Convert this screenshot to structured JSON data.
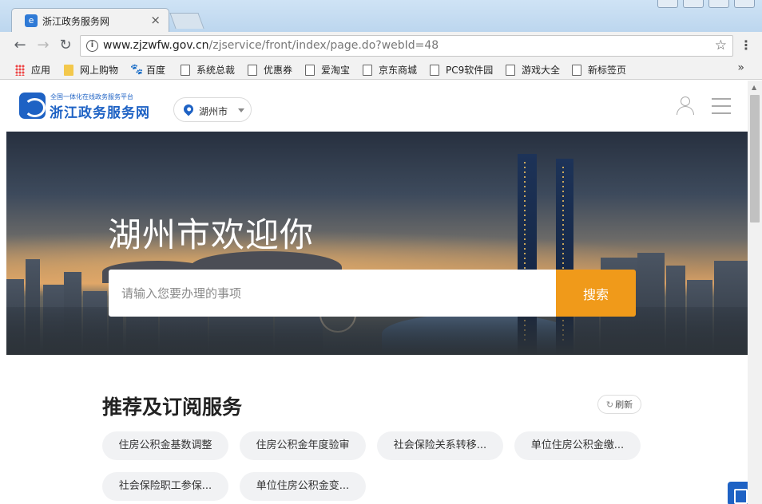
{
  "browser": {
    "tab_title": "浙江政务服务网",
    "tab_close": "×",
    "url_host": "www.zjzwfw.gov.cn",
    "url_path": "/zjservice/front/index/page.do?webId=48",
    "back_glyph": "←",
    "forward_glyph": "→",
    "reload_glyph": "↻",
    "star_glyph": "☆",
    "info_glyph": "i",
    "menu_glyph": "⋮",
    "more_glyph": "»"
  },
  "bookmarks": [
    {
      "label": "应用",
      "icon": "apps-grid-icon"
    },
    {
      "label": "网上购物",
      "icon": "folder-icon"
    },
    {
      "label": "百度",
      "icon": "baidu-paw-icon"
    },
    {
      "label": "系统总裁",
      "icon": "page-icon"
    },
    {
      "label": "优惠券",
      "icon": "page-icon"
    },
    {
      "label": "爱淘宝",
      "icon": "page-icon"
    },
    {
      "label": "京东商城",
      "icon": "page-icon"
    },
    {
      "label": "PC9软件园",
      "icon": "page-icon"
    },
    {
      "label": "游戏大全",
      "icon": "page-icon"
    },
    {
      "label": "新标签页",
      "icon": "page-icon"
    }
  ],
  "site": {
    "logo_subtitle": "全国一体化在线政务服务平台",
    "logo_title": "浙江政务服务网",
    "city": "湖州市",
    "accent_color": "#1e62c4"
  },
  "banner": {
    "welcome": "湖州市欢迎你",
    "search_placeholder": "请输入您要办理的事项",
    "search_button": "搜索",
    "search_button_color": "#f09a1a"
  },
  "recommend": {
    "title": "推荐及订阅服务",
    "refresh_label": "刷新",
    "services": [
      "住房公积金基数调整",
      "住房公积金年度验审",
      "社会保险关系转移...",
      "单位住房公积金缴...",
      "社会保险职工参保...",
      "单位住房公积金变..."
    ]
  }
}
